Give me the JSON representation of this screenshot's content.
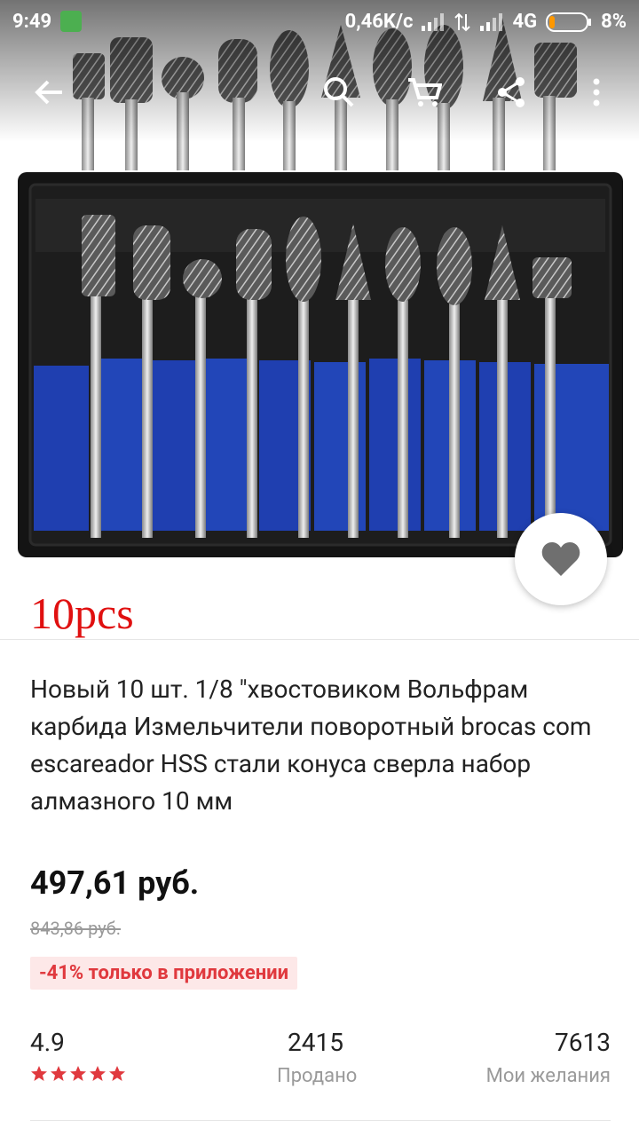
{
  "status_bar": {
    "time": "9:49",
    "speed": "0,46K/c",
    "network": "4G",
    "battery": "8%"
  },
  "product": {
    "image_caption": "10pcs",
    "title": "Новый 10 шт. 1/8 \"хвостовиком Вольфрам карбида Измельчители поворотный brocas com escareador HSS стали конуса сверла набор алмазного 10 мм",
    "price": "497,61 руб.",
    "old_price": "843,86 руб.",
    "discount_badge": "-41% только в приложении"
  },
  "stats": {
    "rating": "4.9",
    "stars": 5,
    "sold_count": "2415",
    "sold_label": "Продано",
    "wish_count": "7613",
    "wish_label": "Мои желания"
  },
  "icons": [
    "back-arrow-icon",
    "search-icon",
    "cart-icon",
    "share-icon",
    "more-vert-icon",
    "heart-icon",
    "star-icon"
  ],
  "colors": {
    "accent_red": "#e0393e",
    "foam_blue": "#1f3fb0",
    "case_black": "#1a1a1a"
  }
}
